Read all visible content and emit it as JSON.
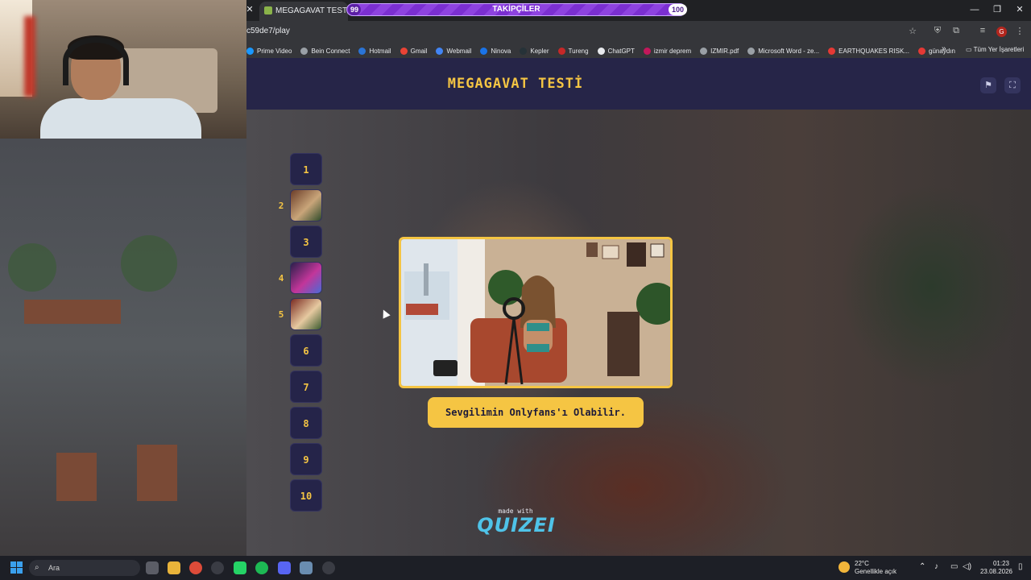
{
  "browser": {
    "tab_title": "MEGAGAVAT TESTİ - Tier L",
    "url": "c59de7/play",
    "window_controls": [
      "—",
      "❐",
      "✕"
    ],
    "bookmarks": [
      {
        "label": "Prime Video",
        "color": "#1a98ff"
      },
      {
        "label": "Bein Connect",
        "color": "#9aa0a6"
      },
      {
        "label": "Hotmail",
        "color": "#2a74d6"
      },
      {
        "label": "Gmail",
        "color": "#ea4335"
      },
      {
        "label": "Webmail",
        "color": "#4285f4"
      },
      {
        "label": "Ninova",
        "color": "#1a73e8"
      },
      {
        "label": "Kepler",
        "color": "#263238"
      },
      {
        "label": "Tureng",
        "color": "#c62828"
      },
      {
        "label": "ChatGPT",
        "color": "#e8eaed"
      },
      {
        "label": "izmir deprem",
        "color": "#c2185b"
      },
      {
        "label": "IZMIR.pdf",
        "color": "#9aa0a6"
      },
      {
        "label": "Microsoft Word - ze...",
        "color": "#9aa0a6"
      },
      {
        "label": "EARTHQUAKES RISK...",
        "color": "#e53935"
      },
      {
        "label": "günaydın",
        "color": "#e53935"
      }
    ],
    "all_bookmarks": "Tüm Yer İşaretleri",
    "profile_initial": "G"
  },
  "followers_bar": {
    "label": "TAKİPÇİLER",
    "min": "99",
    "max": "100",
    "progress": 0.99
  },
  "quiz": {
    "title": "MEGAGAVAT TESTİ",
    "ranks": [
      {
        "num": "1",
        "has_image": false
      },
      {
        "num": "2",
        "has_image": true
      },
      {
        "num": "3",
        "has_image": false
      },
      {
        "num": "4",
        "has_image": true
      },
      {
        "num": "5",
        "has_image": true
      },
      {
        "num": "6",
        "has_image": false
      },
      {
        "num": "7",
        "has_image": false
      },
      {
        "num": "8",
        "has_image": false
      },
      {
        "num": "9",
        "has_image": false
      },
      {
        "num": "10",
        "has_image": false
      }
    ],
    "caption": "Sevgilimin Onlyfans'ı Olabilir.",
    "made_with": "made with",
    "brand": "QUIZEI"
  },
  "taskbar": {
    "search_placeholder": "Ara",
    "weather_temp": "22°C",
    "weather_desc": "Genellikle açık",
    "time": "01:23",
    "date": "23.08.2026"
  },
  "colors": {
    "accent": "#f5c543",
    "header_bg": "#262548",
    "rank_bg": "#252449",
    "brand": "#4fc3e8",
    "followers_bar": "#7b2fd1"
  }
}
